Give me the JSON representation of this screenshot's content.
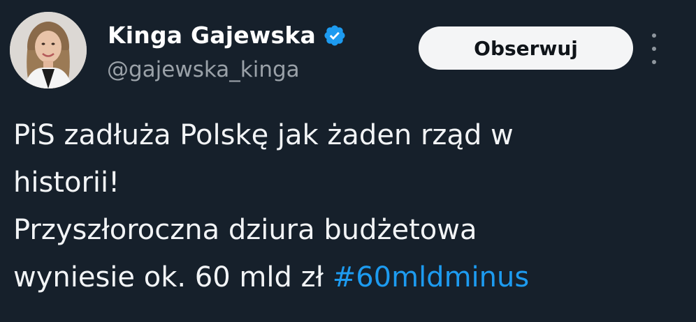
{
  "tweet": {
    "author": {
      "display_name": "Kinga Gajewska",
      "handle": "@gajewska_kinga",
      "verified_icon": "verified-badge-icon"
    },
    "follow_label": "Obserwuj",
    "more_icon": "more-vertical-icon",
    "text_lines": [
      "PiS zadłuża Polskę jak żaden rząd w",
      "historii!",
      "Przyszłoroczna dziura budżetowa",
      "wyniesie ok. 60 mld zł "
    ],
    "hashtag": "#60mldminus"
  },
  "colors": {
    "background": "#15202b",
    "text": "#f2f4f6",
    "muted": "#9aa1a8",
    "accent": "#1d9bf0",
    "button_bg": "#f4f5f6"
  }
}
